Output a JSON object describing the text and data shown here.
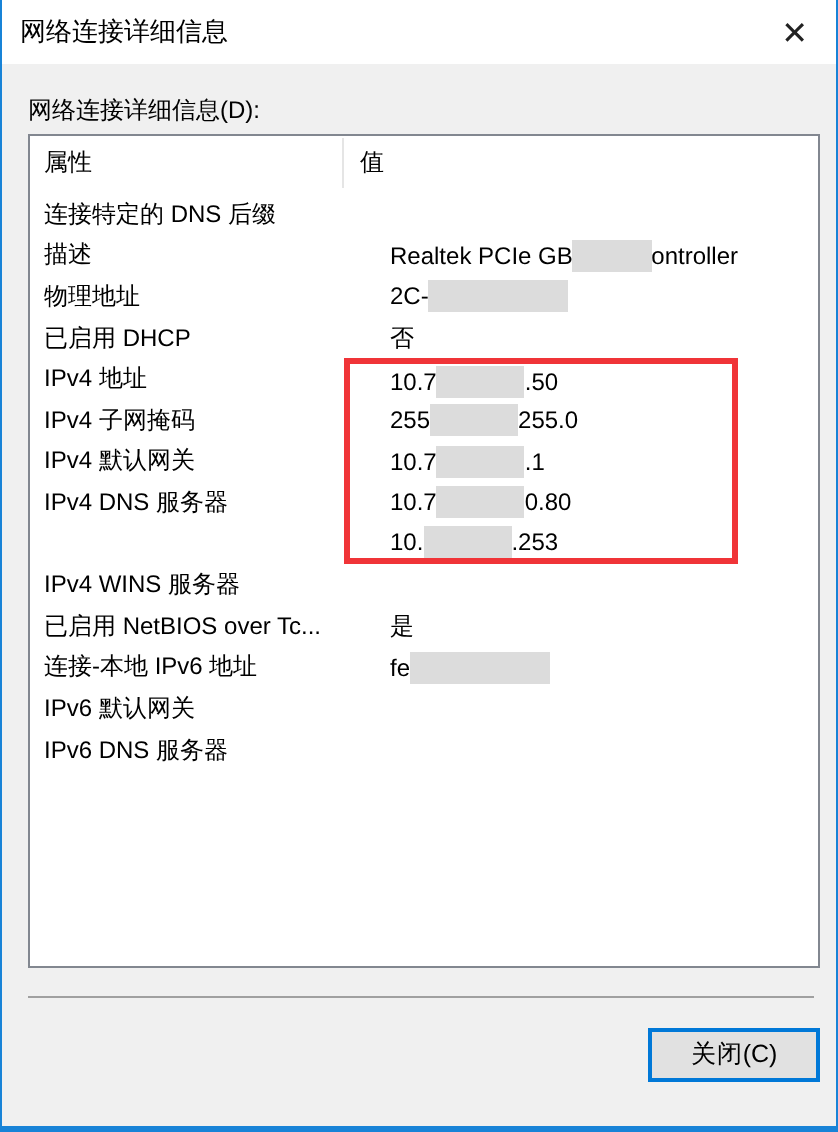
{
  "window": {
    "title": "网络连接详细信息",
    "close": "✕"
  },
  "list_label": "网络连接详细信息(D):",
  "table": {
    "columns": [
      "属性",
      "值"
    ],
    "rows": [
      {
        "property": "连接特定的 DNS 后缀",
        "highlighted": false
      },
      {
        "property": "描述",
        "parts": [
          "Realtek PCIe GB",
          "ontroller"
        ],
        "highlighted": false
      },
      {
        "property": "物理地址",
        "parts": [
          "2C-"
        ],
        "highlighted": false
      },
      {
        "property": "已启用 DHCP",
        "value": "否",
        "highlighted": false
      },
      {
        "property": "IPv4 地址",
        "parts": [
          "10.7",
          ".50"
        ],
        "highlighted": true
      },
      {
        "property": "IPv4 子网掩码",
        "parts": [
          "255",
          "255.0"
        ],
        "highlighted": true
      },
      {
        "property": "IPv4 默认网关",
        "parts": [
          "10.7",
          ".1"
        ],
        "highlighted": true
      },
      {
        "property": "IPv4 DNS 服务器",
        "parts": [
          "10.7",
          "0.80"
        ],
        "highlighted": true
      },
      {
        "parts": [
          "10.",
          ".253"
        ],
        "highlighted": true
      },
      {
        "property": "IPv4 WINS 服务器",
        "highlighted": false
      },
      {
        "property": "已启用 NetBIOS over Tc...",
        "value": "是",
        "highlighted": false
      },
      {
        "property": "连接-本地 IPv6 地址",
        "parts": [
          "fe"
        ],
        "highlighted": false
      },
      {
        "property": "IPv6 默认网关",
        "highlighted": false
      },
      {
        "property": "IPv6 DNS 服务器",
        "highlighted": false
      }
    ]
  },
  "buttons": [
    {
      "label": "关闭(C)",
      "focused": true
    }
  ]
}
